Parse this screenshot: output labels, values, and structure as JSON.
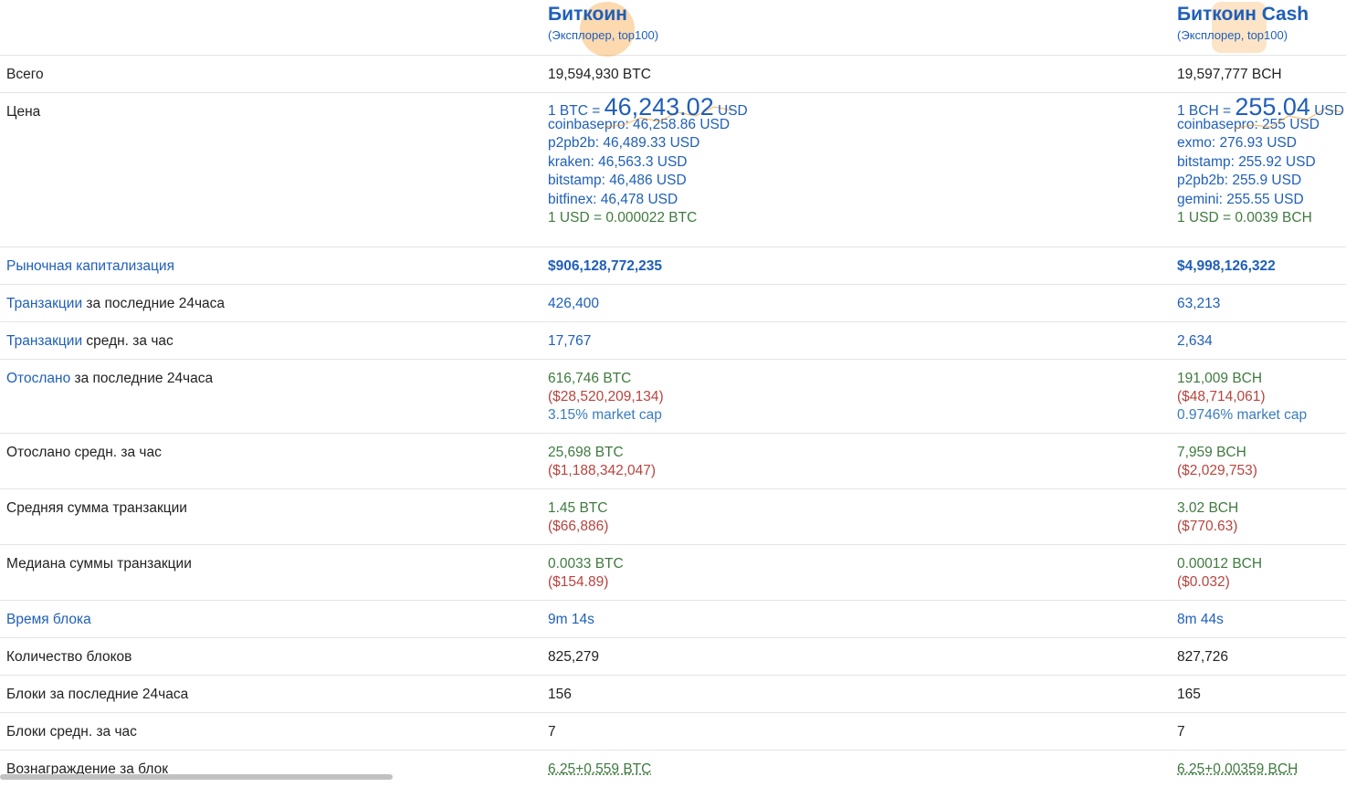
{
  "coins": [
    {
      "name": "Биткоин",
      "sub_open": "(",
      "explorer": "Эксплорер",
      "sep": ", ",
      "top": "top100",
      "sub_close": ")"
    },
    {
      "name": "Биткоин Cash",
      "sub_open": "(",
      "explorer": "Эксплорер",
      "sep": ", ",
      "top": "top100",
      "sub_close": ")"
    }
  ],
  "rows": {
    "total": {
      "label": "Всего",
      "btc": "19,594,930 BTC",
      "bch": "19,597,777 BCH"
    },
    "price": {
      "label": "Цена",
      "btc": {
        "prefix": "1 BTC = ",
        "big": "46,243.02",
        "suffix": " USD",
        "exchanges": [
          "coinbasepro: 46,258.86 USD",
          "p2pb2b: 46,489.33 USD",
          "kraken: 46,563.3 USD",
          "bitstamp: 46,486 USD",
          "bitfinex: 46,478 USD"
        ],
        "inverse": "1 USD = 0.000022 BTC"
      },
      "bch": {
        "prefix": "1 BCH = ",
        "big": "255.04",
        "suffix": " USD",
        "exchanges": [
          "coinbasepro: 255 USD",
          "exmo: 276.93 USD",
          "bitstamp: 255.92 USD",
          "p2pb2b: 255.9 USD",
          "gemini: 255.55 USD"
        ],
        "inverse": "1 USD = 0.0039 BCH"
      }
    },
    "market_cap": {
      "label": "Рыночная капитализация",
      "btc": "$906,128,772,235",
      "bch": "$4,998,126,322"
    },
    "tx24": {
      "label_link": "Транзакции",
      "label_rest": " за последние 24часа",
      "btc": "426,400",
      "bch": "63,213"
    },
    "tx_hour": {
      "label_link": "Транзакции",
      "label_rest": " средн. за час",
      "btc": "17,767",
      "bch": "2,634"
    },
    "sent24": {
      "label_link": "Отослано",
      "label_rest": " за последние 24часа",
      "btc": {
        "amount": "616,746 BTC",
        "usd": "($28,520,209,134)",
        "cap": "3.15% market cap"
      },
      "bch": {
        "amount": "191,009 BCH",
        "usd": "($48,714,061)",
        "cap": "0.9746% market cap"
      }
    },
    "sent_hour": {
      "label": "Отослано средн. за час",
      "btc": {
        "amount": "25,698 BTC",
        "usd": "($1,188,342,047)"
      },
      "bch": {
        "amount": "7,959 BCH",
        "usd": "($2,029,753)"
      }
    },
    "avg_tx": {
      "label": "Средняя сумма транзакции",
      "btc": {
        "amount": "1.45 BTC",
        "usd": "($66,886)"
      },
      "bch": {
        "amount": "3.02 BCH",
        "usd": "($770.63)"
      }
    },
    "median_tx": {
      "label": "Медиана суммы транзакции",
      "btc": {
        "amount": "0.0033 BTC",
        "usd": "($154.89)"
      },
      "bch": {
        "amount": "0.00012 BCH",
        "usd": "($0.032)"
      }
    },
    "block_time": {
      "label": "Время блока",
      "btc": "9m 14s",
      "bch": "8m 44s"
    },
    "block_count": {
      "label": "Количество блоков",
      "btc": "825,279",
      "bch": "827,726"
    },
    "blocks24": {
      "label": "Блоки за последние 24часа",
      "btc": "156",
      "bch": "165"
    },
    "blocks_hour": {
      "label": "Блоки средн. за час",
      "btc": "7",
      "bch": "7"
    },
    "reward": {
      "label": "Вознаграждение за блок",
      "btc": "6.25+0.559 BTC",
      "bch": "6.25+0.00359 BCH"
    }
  },
  "colors": {
    "link": "#1f5fb8",
    "green": "#3f7a3f",
    "red": "#b8443e",
    "steel": "#3a7cbf",
    "spark": "#f7931a"
  }
}
